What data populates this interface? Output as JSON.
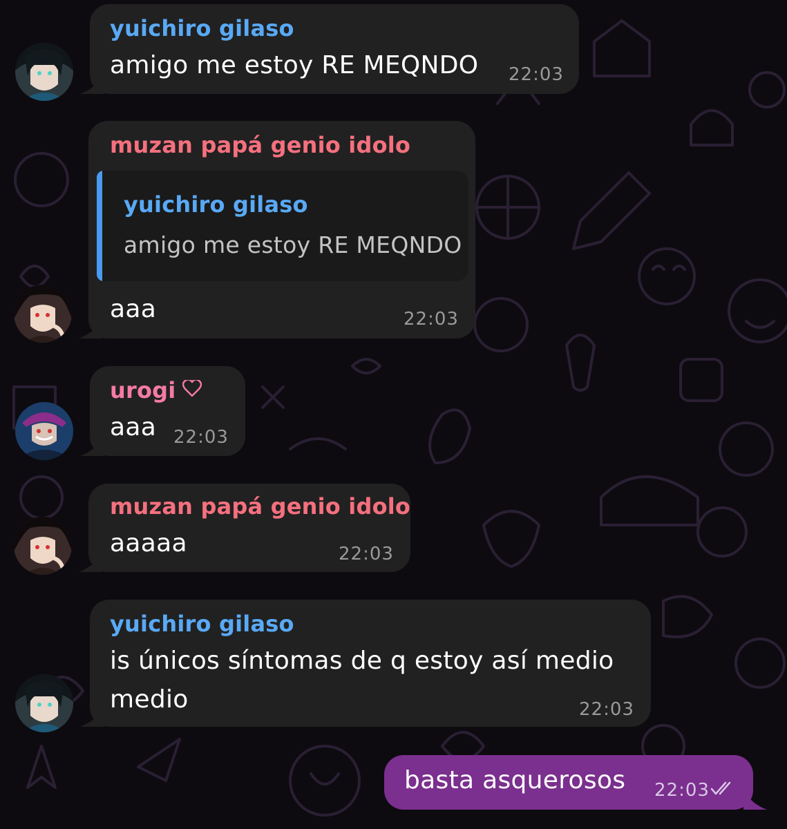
{
  "colors": {
    "yuichiro_name": "#59a9f5",
    "muzan_name": "#f5707e",
    "urogi_name": "#f47ba4",
    "outgoing_bubble": "#7b2f8e",
    "incoming_bubble": "#212121"
  },
  "messages": [
    {
      "sender": "yuichiro gilaso",
      "avatar": "yuichiro-avatar",
      "text": "amigo me estoy RE MEQNDO",
      "time": "22:03"
    },
    {
      "sender": "muzan papá genio idolo",
      "avatar": "muzan-avatar",
      "reply": {
        "sender": "yuichiro gilaso",
        "text": "amigo me estoy RE MEQNDO"
      },
      "text": "aaa",
      "time": "22:03"
    },
    {
      "sender": "urogi",
      "sender_icon": "heart-icon",
      "avatar": "urogi-avatar",
      "text": "aaa",
      "time": "22:03"
    },
    {
      "sender": "muzan papá genio idolo",
      "avatar": "muzan-avatar",
      "text": "aaaaa",
      "time": "22:03"
    },
    {
      "sender": "yuichiro gilaso",
      "avatar": "yuichiro-avatar",
      "text_lines": [
        "is únicos síntomas de q estoy así medio",
        "medio"
      ],
      "time": "22:03"
    },
    {
      "outgoing": true,
      "text": "basta asquerosos",
      "time": "22:03",
      "status_icon": "double-check-read-icon"
    }
  ]
}
